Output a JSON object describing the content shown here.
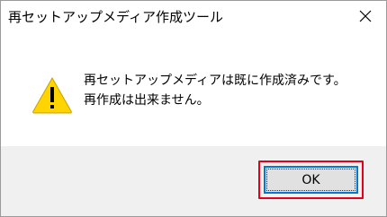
{
  "window": {
    "title": "再セットアップメディア作成ツール",
    "close_icon": "close-icon"
  },
  "message": {
    "icon": "warning-icon",
    "line1": "再セットアップメディアは既に作成済みです。",
    "line2": "再作成は出来ません。"
  },
  "footer": {
    "ok_label": "OK"
  },
  "colors": {
    "highlight": "#e3001b",
    "button_focus_border": "#0078d7",
    "footer_bg": "#f0f0f0",
    "warning_fill": "#ffd400"
  }
}
